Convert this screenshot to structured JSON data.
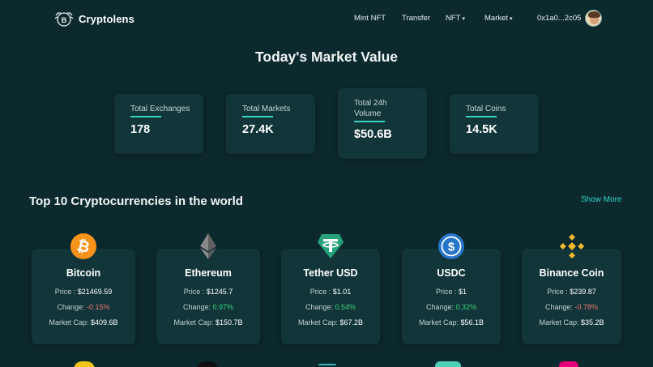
{
  "app": {
    "name": "Cryptolens"
  },
  "nav": {
    "mint": "Mint NFT",
    "transfer": "Transfer",
    "nft": "NFT",
    "market": "Market",
    "wallet": "0x1a0...2c05"
  },
  "hero": {
    "title": "Today's Market Value",
    "stats": [
      {
        "label": "Total Exchanges",
        "value": "178"
      },
      {
        "label": "Total Markets",
        "value": "27.4K"
      },
      {
        "label": "Total 24h Volume",
        "value": "$50.6B"
      },
      {
        "label": "Total Coins",
        "value": "14.5K"
      }
    ]
  },
  "top": {
    "title": "Top 10 Cryptocurrencies in the world",
    "show_more": "Show More",
    "price_label": "Price :",
    "change_label": "Change:",
    "cap_label": "Market Cap:",
    "coins": [
      {
        "name": "Bitcoin",
        "price": "$21469.59",
        "change": "-0.15%",
        "cap": "$409.6B",
        "icon": "bitcoin-icon",
        "color": "#f7931a",
        "change_dir": "down"
      },
      {
        "name": "Ethereum",
        "price": "$1245.7",
        "change": "0.97%",
        "cap": "$150.7B",
        "icon": "ethereum-icon",
        "color": "#8c8c8c",
        "change_dir": "up"
      },
      {
        "name": "Tether USD",
        "price": "$1.01",
        "change": "0.54%",
        "cap": "$67.2B",
        "icon": "tether-icon",
        "color": "#26a17b",
        "change_dir": "up"
      },
      {
        "name": "USDC",
        "price": "$1",
        "change": "0.32%",
        "cap": "$56.1B",
        "icon": "usdc-icon",
        "color": "#2775ca",
        "change_dir": "up"
      },
      {
        "name": "Binance Coin",
        "price": "$239.87",
        "change": "-0.78%",
        "cap": "$35.2B",
        "icon": "binance-icon",
        "color": "#f3ba2f",
        "change_dir": "down"
      }
    ]
  },
  "colors": {
    "background": "#0c2a2e",
    "card": "#113539",
    "accent": "#37d3c3",
    "positive": "#3fd37a",
    "negative": "#f0726e"
  }
}
